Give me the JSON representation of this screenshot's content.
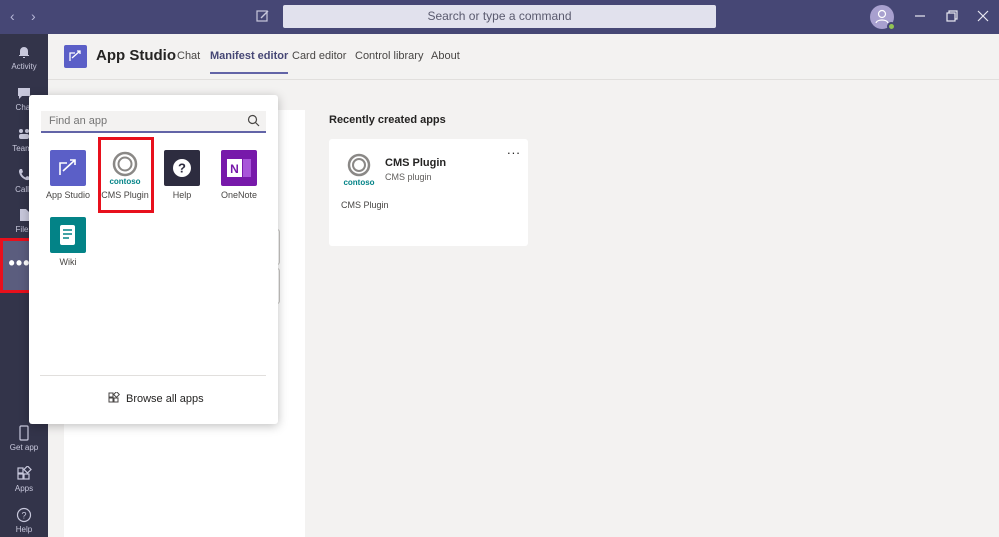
{
  "titlebar": {
    "search_placeholder": "Search or type a command",
    "back_icon": "chevron-left-icon",
    "forward_icon": "chevron-right-icon",
    "compose_icon": "compose-icon",
    "presence": "available"
  },
  "rail": {
    "items": [
      {
        "label": "Activity",
        "icon": "bell-icon"
      },
      {
        "label": "Chat",
        "icon": "chat-icon"
      },
      {
        "label": "Teams",
        "icon": "teams-icon"
      },
      {
        "label": "Calls",
        "icon": "phone-icon"
      },
      {
        "label": "Files",
        "icon": "file-icon"
      }
    ],
    "more_icon": "more-icon",
    "bottom_items": [
      {
        "label": "Get app",
        "icon": "device-icon"
      },
      {
        "label": "Apps",
        "icon": "apps-icon"
      },
      {
        "label": "Help",
        "icon": "help-icon"
      }
    ]
  },
  "app_header": {
    "title": "App Studio",
    "tabs": [
      {
        "label": "Chat",
        "active": false
      },
      {
        "label": "Manifest editor",
        "active": true
      },
      {
        "label": "Card editor",
        "active": false
      },
      {
        "label": "Control library",
        "active": false
      },
      {
        "label": "About",
        "active": false
      }
    ]
  },
  "flyout": {
    "search_placeholder": "Find an app",
    "apps": [
      {
        "label": "App Studio",
        "color": "#5b5fc7",
        "icon": "app-studio-icon"
      },
      {
        "label": "CMS Plugin",
        "color": "#ffffff",
        "icon": "contoso-logo-icon",
        "logo_text": "contoso"
      },
      {
        "label": "Help",
        "color": "#2d2c3f",
        "icon": "question-icon"
      },
      {
        "label": "OneNote",
        "color": "#7719aa",
        "icon": "onenote-icon",
        "logo_text": "N"
      },
      {
        "label": "Wiki",
        "color": "#038387",
        "icon": "wiki-icon"
      }
    ],
    "browse_label": "Browse all apps"
  },
  "recent": {
    "heading": "Recently created apps",
    "cards": [
      {
        "name": "CMS Plugin",
        "subtitle": "CMS plugin",
        "description": "CMS Plugin",
        "logo_text": "contoso",
        "more": "..."
      }
    ]
  }
}
